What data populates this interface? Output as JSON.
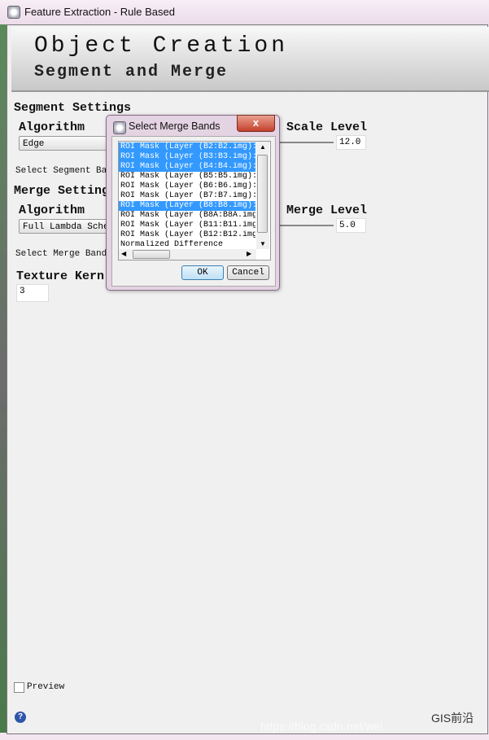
{
  "window": {
    "title": "Feature Extraction - Rule Based"
  },
  "banner": {
    "title": "Object Creation",
    "subtitle": "Segment and Merge"
  },
  "segment": {
    "heading": "Segment Settings",
    "algorithm_label": "Algorithm",
    "algorithm_value": "Edge",
    "scale_label": "Scale Level",
    "scale_value": "12.0",
    "select_bands_label": "Select Segment Ban"
  },
  "merge": {
    "heading": "Merge Setting",
    "algorithm_label": "Algorithm",
    "algorithm_value": "Full Lambda Sched",
    "level_label": "Merge Level",
    "level_value": "5.0",
    "select_bands_label": "Select Merge Bands"
  },
  "texture": {
    "label": "Texture Kern",
    "value": "3"
  },
  "preview": {
    "label": "Preview",
    "checked": false
  },
  "dialog": {
    "title": "Select Merge Bands",
    "close": "x",
    "ok": "OK",
    "cancel": "Cancel",
    "items": [
      {
        "label": "ROI Mask (Layer (B2:B2.img):",
        "selected": true
      },
      {
        "label": "ROI Mask (Layer (B3:B3.img):",
        "selected": true
      },
      {
        "label": "ROI Mask (Layer (B4:B4.img):",
        "selected": true
      },
      {
        "label": "ROI Mask (Layer (B5:B5.img):",
        "selected": false
      },
      {
        "label": "ROI Mask (Layer (B6:B6.img):",
        "selected": false
      },
      {
        "label": "ROI Mask (Layer (B7:B7.img):",
        "selected": false
      },
      {
        "label": "ROI Mask (Layer (B8:B8.img):",
        "selected": true
      },
      {
        "label": "ROI Mask (Layer (B8A:B8A.img",
        "selected": false
      },
      {
        "label": "ROI Mask (Layer (B11:B11.img",
        "selected": false
      },
      {
        "label": "ROI Mask (Layer (B12:B12.img",
        "selected": false
      },
      {
        "label": "Normalized Difference",
        "selected": false
      }
    ]
  },
  "watermark": {
    "text": "GIS前沿",
    "url": "https://blog.csdn.net/wei"
  },
  "colors": {
    "selection": "#3399ff",
    "close": "#c4412c"
  }
}
